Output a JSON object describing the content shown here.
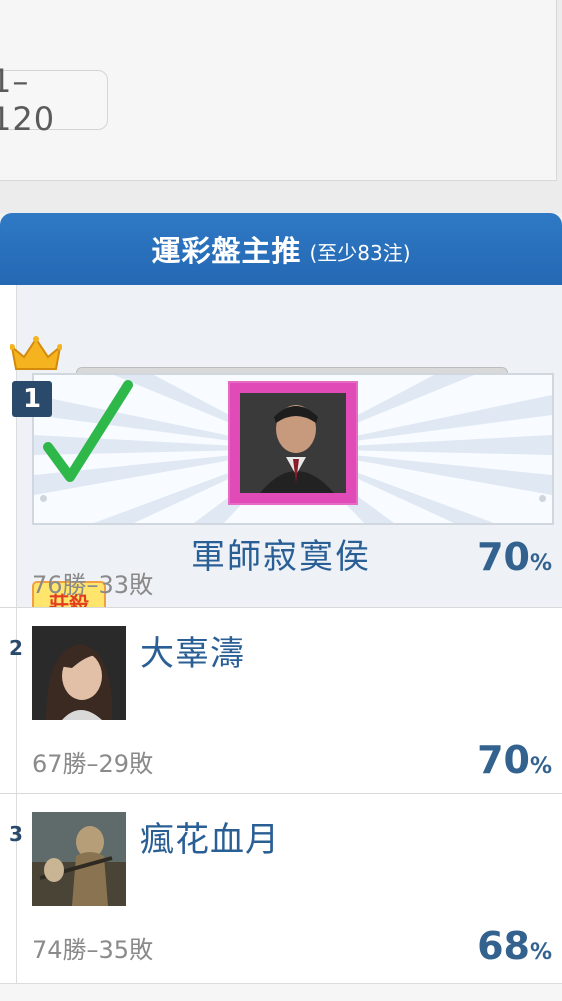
{
  "top_card": {
    "record_partial": "1–120"
  },
  "panel": {
    "title": "運彩盤主推",
    "subtitle": "(至少83注)"
  },
  "entries": [
    {
      "rank": "1",
      "name": "軍師寂寞侯",
      "tag": "莊殺",
      "record": "76勝–33敗",
      "pct": "70",
      "pct_unit": "%"
    },
    {
      "rank": "2",
      "name": "大辜濤",
      "record": "67勝–29敗",
      "pct": "70",
      "pct_unit": "%"
    },
    {
      "rank": "3",
      "name": "瘋花血月",
      "record": "74勝–35敗",
      "pct": "68",
      "pct_unit": "%"
    }
  ],
  "icons": {
    "crown": "crown-icon",
    "check": "checkmark-icon"
  },
  "colors": {
    "header_blue": "#2468b3",
    "name_blue": "#2a5f96",
    "pct_blue": "#33628f",
    "check_green": "#2fb84a",
    "tag_yellow": "#ffe56b",
    "tag_red": "#e23d1f"
  }
}
